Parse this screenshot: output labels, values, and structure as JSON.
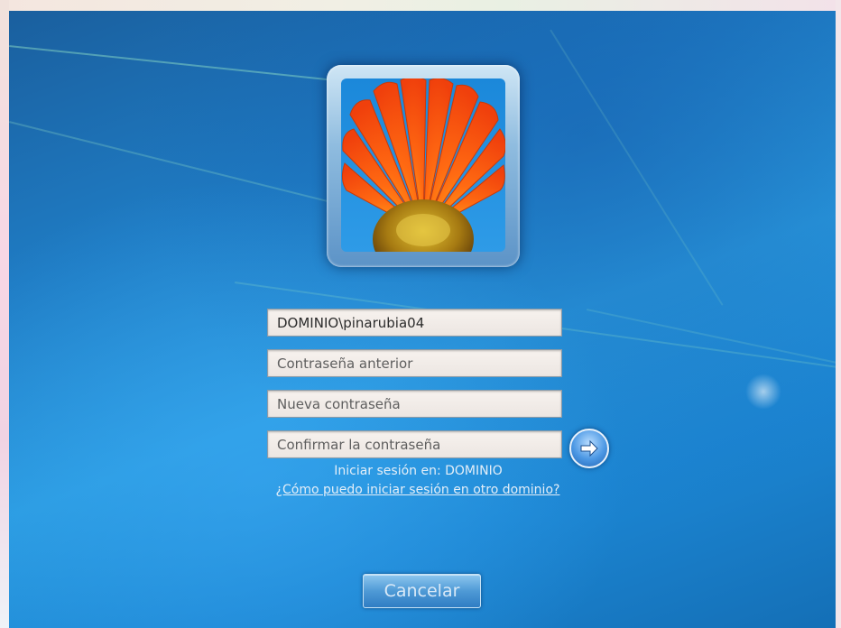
{
  "login": {
    "username_value": "DOMINIO\\pinarubia04",
    "old_password_placeholder": "Contraseña anterior",
    "new_password_placeholder": "Nueva contraseña",
    "confirm_password_placeholder": "Confirmar la contraseña",
    "signin_domain_text": "Iniciar sesión en: DOMINIO",
    "other_domain_link": "¿Cómo puedo iniciar sesión en otro dominio?",
    "cancel_label": "Cancelar",
    "submit_icon": "arrow-right-icon"
  },
  "avatar": {
    "icon": "flower-avatar-icon"
  },
  "colors": {
    "background": "#1f7cc4",
    "field_background": "#f2ece8",
    "text_light": "#e3eef8",
    "button_blue": "#4f9ad6"
  }
}
